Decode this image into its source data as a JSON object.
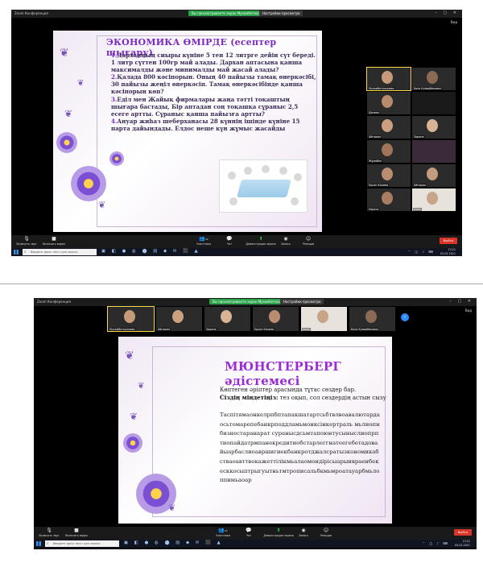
{
  "screenshot1": {
    "window_title": "Zoom Конференция",
    "notice_green": "Вы просматриваете экран Мухамбеткалиева",
    "notice_dark": "Настройки просмотра",
    "view_label": "Вид",
    "slide": {
      "title": "ЭКОНОМИКА ӨМІРДЕ (есептер шығару)",
      "problems": [
        {
          "num": "1.",
          "text": "Дарханның сиыры күніне 5 тен 12 литрге дейін сүт береді. 1 литр сүттен 100гр май алады. Дархан аптасына қанша максималды және минималды май жасай алады?"
        },
        {
          "num": "2.",
          "text": "Қалада 800 кәсіпорын. Оның 40 пайызы тамақ өнеркәсібі, 30 пайызы жеңіл өнеркәсіп. Тамақ өнеркәсібінде қанша кәсіпорын көп?"
        },
        {
          "num": "3.",
          "text": "Еділ мен Жайық фирмалары жаңа тәтті тоқаштың шығара бастады, Бір аптадан соң тоқашқа сұраныс 2,5 есеге артты. Сұраныс қанша пайызға артты?"
        },
        {
          "num": "4.",
          "text": "Ануар жиһаз шеберханасы 28 күннің ішінде күніне 15 парта дайындады. Елдос неше күн жұмыс жасайды"
        }
      ]
    },
    "participants": [
      {
        "name": "Мухамбеткалиева"
      },
      {
        "name": "Баха Кумарбекович"
      },
      {
        "name": "Даниял"
      },
      {
        "name": ""
      },
      {
        "name": "Айгерим"
      },
      {
        "name": "Зарина"
      },
      {
        "name": "Жұмабек"
      },
      {
        "name": ""
      },
      {
        "name": "Ерлан Калиев"
      },
      {
        "name": "Айгерим"
      },
      {
        "name": "Наргиз"
      },
      {
        "name": "Алия"
      }
    ],
    "controls": {
      "mic": "Включить звук",
      "video": "Включить видео",
      "participants": "Участники",
      "participants_count": "22",
      "chat": "Чат",
      "share": "Демонстрация экрана",
      "record": "Запись",
      "reactions": "Реакции",
      "end": "Выйти"
    },
    "taskbar": {
      "search_placeholder": "Введите здесь текст для поиска",
      "time": "13:21",
      "date": "05.02.2021"
    }
  },
  "screenshot2": {
    "window_title": "Zoom Конференция",
    "notice_green": "Вы просматриваете экран Мухамбеткалиева",
    "notice_dark": "Настройки просмотра",
    "view_label": "Вид",
    "slide": {
      "title": "МЮНСТЕРБЕРГ әдістемесі",
      "line1": "Көптеген әріптер арасында тұтас сөздер бар.",
      "task_label": "Сіздің міндетіңіз:",
      "task_text": " тез оқып, сол сөздердің астын сызу",
      "letters": "Таспітямаонкелрпбптапакшатартсьбтвлвоавалютардаосьтомарепебанкрподдламьмонксінкертраль мьлиопнбизнестаранарат суранысдсьмтапоюнтусыныслиопрптиопайдатрмпанекредитиобстарлеггнатеегебетадовайыарбаслиоавршигиекбанкротджалсратызкономикабстваоавттвокажеттілікмьалаомоидірісыарыивраенбекесккосыптрыгуытньтмтрописальбкмьмроатауарбмьлоппимьаоар"
    },
    "participants": [
      {
        "name": "Мухамбеткалиева"
      },
      {
        "name": "Айгерим"
      },
      {
        "name": "Зарина"
      },
      {
        "name": "Ерлан Калиев"
      },
      {
        "name": "Алия"
      },
      {
        "name": "Баха Кумарбекович"
      }
    ],
    "controls": {
      "mic": "Включить звук",
      "video": "Включить видео",
      "participants": "Участники",
      "participants_count": "22",
      "chat": "Чат",
      "share": "Демонстрация экрана",
      "record": "Запись",
      "reactions": "Реакции",
      "end": "Выйти"
    },
    "taskbar": {
      "search_placeholder": "Введите здесь текст для поиска",
      "time": "13:22",
      "date": "05.02.2021"
    }
  }
}
